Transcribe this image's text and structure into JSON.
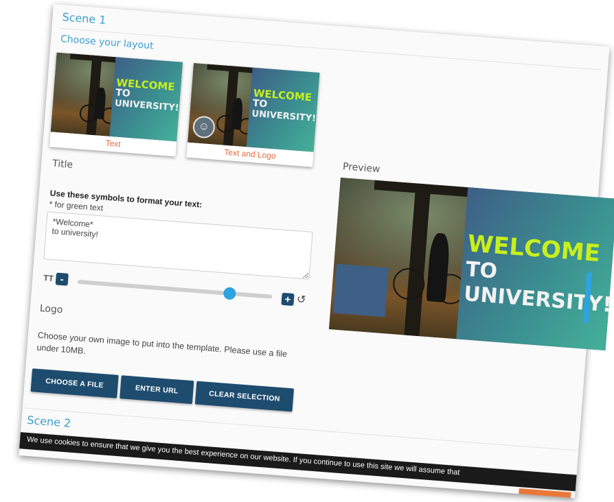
{
  "scene1": {
    "title": "Scene 1",
    "choose_layout": "Choose your layout",
    "layouts": [
      {
        "label": "Text"
      },
      {
        "label": "Text and Logo"
      }
    ],
    "template_text": {
      "line1": "WELCOME",
      "line2": "TO",
      "line3": "UNIVERSITY!"
    }
  },
  "title_section": {
    "heading": "Title",
    "format_help": "Use these symbols to format your text:",
    "format_hint": "* for green text",
    "text_value": "*Welcome*\nto university!"
  },
  "font_size": {
    "icon_text": "TT",
    "minus": "-",
    "plus": "+",
    "value": 0.8
  },
  "logo_section": {
    "heading": "Logo",
    "description": "Choose your own image to put into the template. Please use a file under 10MB.",
    "buttons": {
      "choose_file": "Choose a file",
      "enter_url": "Enter URL",
      "clear_selection": "Clear selection"
    }
  },
  "preview": {
    "heading": "Preview"
  },
  "scene2": {
    "title": "Scene 2"
  },
  "cookie_text": "We use cookies to ensure that we give you the best experience on our website. If you continue to use this site we will assume that",
  "icons": {
    "reset": "reset-icon",
    "text-size": "text-size-icon"
  },
  "colors": {
    "accent_blue": "#3b9fd0",
    "button_navy": "#1e4c6e",
    "label_orange": "#e8683a",
    "welcome_lime": "#c7ef1d",
    "slider_blue": "#2ea3df"
  }
}
